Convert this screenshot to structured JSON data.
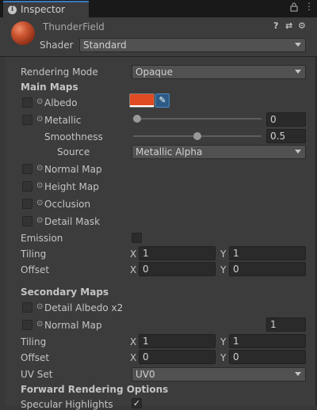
{
  "tab": {
    "title": "Inspector",
    "icon": "info-icon"
  },
  "material": {
    "name": "ThunderField",
    "shader_label": "Shader",
    "shader_value": "Standard"
  },
  "rows": {
    "rendering_mode": {
      "label": "Rendering Mode",
      "value": "Opaque"
    },
    "main_maps": "Main Maps",
    "albedo": {
      "label": "Albedo",
      "color": "#E04A22"
    },
    "metallic": {
      "label": "Metallic",
      "value": "0",
      "level": 0
    },
    "smoothness": {
      "label": "Smoothness",
      "value": "0.5",
      "level": 0.5
    },
    "source": {
      "label": "Source",
      "value": "Metallic Alpha"
    },
    "normal_map": "Normal Map",
    "height_map": "Height Map",
    "occlusion": "Occlusion",
    "detail_mask": "Detail Mask",
    "emission": "Emission",
    "tiling": {
      "label": "Tiling",
      "x": "1",
      "y": "1"
    },
    "offset": {
      "label": "Offset",
      "x": "0",
      "y": "0"
    },
    "secondary_maps": "Secondary Maps",
    "detail_albedo": "Detail Albedo x2",
    "normal_map2": {
      "label": "Normal Map",
      "value": "1"
    },
    "tiling2": {
      "label": "Tiling",
      "x": "1",
      "y": "1"
    },
    "offset2": {
      "label": "Offset",
      "x": "0",
      "y": "0"
    },
    "uv_set": {
      "label": "UV Set",
      "value": "UV0"
    },
    "forward_options": "Forward Rendering Options",
    "specular_highlights": {
      "label": "Specular Highlights",
      "checked": true
    }
  },
  "axis": {
    "x": "X",
    "y": "Y"
  }
}
